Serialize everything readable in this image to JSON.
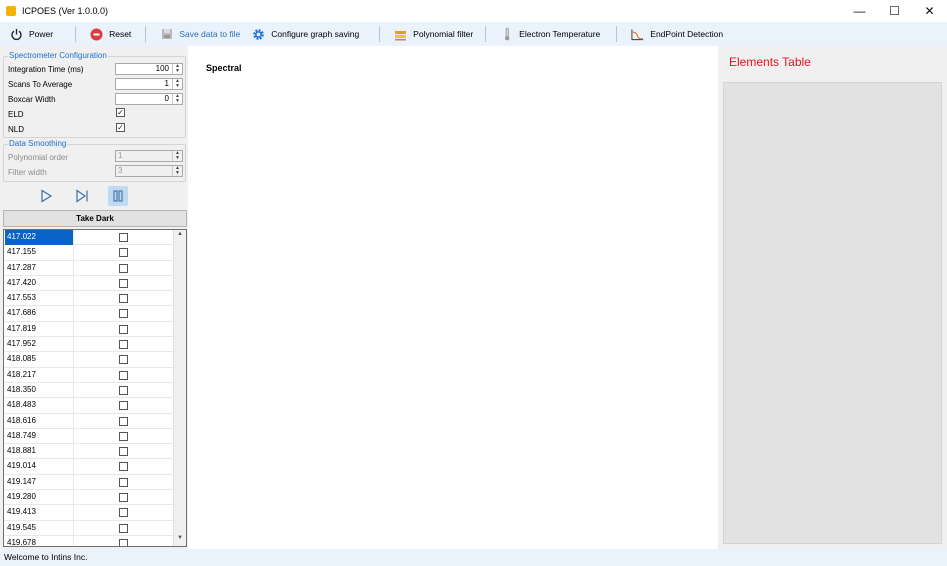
{
  "window": {
    "title": "ICPOES (Ver 1.0.0.0)",
    "minimize_glyph": "—",
    "maximize_glyph": "☐",
    "close_glyph": "✕"
  },
  "toolbar": {
    "power_label": "Power",
    "reset_label": "Reset",
    "save_label": "Save data to file",
    "configure_label": "Configure graph saving",
    "polynomial_label": "Polynomial filter",
    "electron_label": "Electron Temperature",
    "endpoint_label": "EndPoint Detection"
  },
  "spectrometer": {
    "title": "Spectrometer Configuration",
    "integration_label": "Integration Time (ms)",
    "integration_value": "100",
    "scans_label": "Scans To Average",
    "scans_value": "1",
    "boxcar_label": "Boxcar Width",
    "boxcar_value": "0",
    "eld_label": "ELD",
    "eld_checked": true,
    "nld_label": "NLD",
    "nld_checked": true
  },
  "smoothing": {
    "title": "Data Smoothing",
    "poly_order_label": "Polynomial order",
    "poly_order_value": "1",
    "filter_width_label": "Filter width",
    "filter_width_value": "3"
  },
  "take_dark_label": "Take Dark",
  "wavelengths": [
    "417.022",
    "417.155",
    "417.287",
    "417.420",
    "417.553",
    "417.686",
    "417.819",
    "417.952",
    "418.085",
    "418.217",
    "418.350",
    "418.483",
    "418.616",
    "418.749",
    "418.881",
    "419.014",
    "419.147",
    "419.280",
    "419.413",
    "419.545",
    "419.678"
  ],
  "selected_wavelength_index": 0,
  "chart": {
    "title": "Spectral"
  },
  "elements_table": {
    "title": "Elements Table"
  },
  "status": {
    "text": "Welcome to Intins Inc."
  },
  "colors": {
    "accent_blue": "#1e6fd0",
    "selection": "#0a64c8",
    "elements_title": "#e8141e",
    "reset_red": "#e03c3c",
    "toolbar_bg": "#eaf2fb"
  },
  "icons": {
    "power": "power-icon",
    "reset": "stop-circle-icon",
    "save": "disk-icon",
    "configure": "gear-icon",
    "polynomial": "layers-icon",
    "electron": "thermometer-icon",
    "endpoint": "curve-chart-icon",
    "play": "play-icon",
    "step": "step-forward-icon",
    "pause": "pause-icon"
  }
}
